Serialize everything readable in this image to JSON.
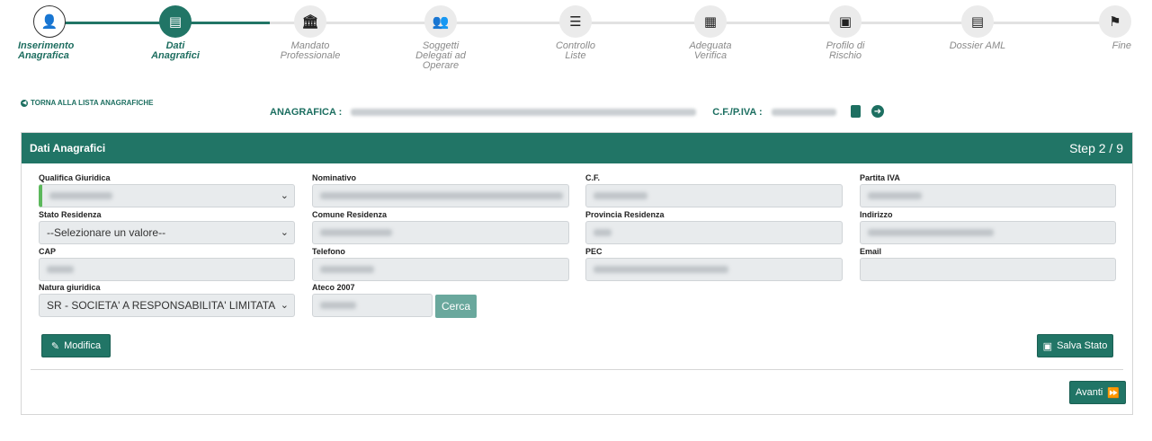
{
  "steps": [
    {
      "label": "Inserimento\nAnagrafica",
      "icon": "user-plus-icon",
      "glyph": "👤",
      "state": "done"
    },
    {
      "label": "Dati\nAnagrafici",
      "icon": "id-card-icon",
      "glyph": "▤",
      "state": "active"
    },
    {
      "label": "Mandato\nProfessionale",
      "icon": "bank-icon",
      "glyph": "🏛",
      "state": "todo"
    },
    {
      "label": "Soggetti\nDelegati ad\nOperare",
      "icon": "users-icon",
      "glyph": "👥",
      "state": "todo"
    },
    {
      "label": "Controllo\nListe",
      "icon": "list-check-icon",
      "glyph": "☰",
      "state": "todo"
    },
    {
      "label": "Adeguata\nVerifica",
      "icon": "clipboard-icon",
      "glyph": "▦",
      "state": "todo"
    },
    {
      "label": "Profilo di\nRischio",
      "icon": "user-badge-icon",
      "glyph": "▣",
      "state": "todo"
    },
    {
      "label": "Dossier AML",
      "icon": "file-icon",
      "glyph": "▤",
      "state": "todo"
    },
    {
      "label": "Fine",
      "icon": "flag-checkered-icon",
      "glyph": "⚑",
      "state": "todo"
    }
  ],
  "back_link": "TORNA ALLA LISTA ANAGRAFICHE",
  "anagrafica_label": "ANAGRAFICA :",
  "cf_label": "C.F./P.IVA :",
  "panel": {
    "title": "Dati Anagrafici",
    "step": "Step 2 / 9"
  },
  "fields": {
    "qualifica": {
      "label": "Qualifica Giuridica"
    },
    "nominativo": {
      "label": "Nominativo"
    },
    "cf": {
      "label": "C.F."
    },
    "piva": {
      "label": "Partita IVA"
    },
    "stato": {
      "label": "Stato Residenza",
      "value": "--Selezionare un valore--"
    },
    "comune": {
      "label": "Comune Residenza"
    },
    "provincia": {
      "label": "Provincia Residenza"
    },
    "indirizzo": {
      "label": "Indirizzo"
    },
    "cap": {
      "label": "CAP"
    },
    "telefono": {
      "label": "Telefono"
    },
    "pec": {
      "label": "PEC"
    },
    "email": {
      "label": "Email"
    },
    "natura": {
      "label": "Natura giuridica",
      "value": "SR - SOCIETA' A RESPONSABILITA' LIMITATA"
    },
    "ateco": {
      "label": "Ateco 2007"
    }
  },
  "buttons": {
    "cerca": "Cerca",
    "modifica": "Modifica",
    "salva": "Salva Stato",
    "avanti": "Avanti"
  },
  "colors": {
    "primary": "#217566",
    "active_bar": "#5cb85c"
  }
}
